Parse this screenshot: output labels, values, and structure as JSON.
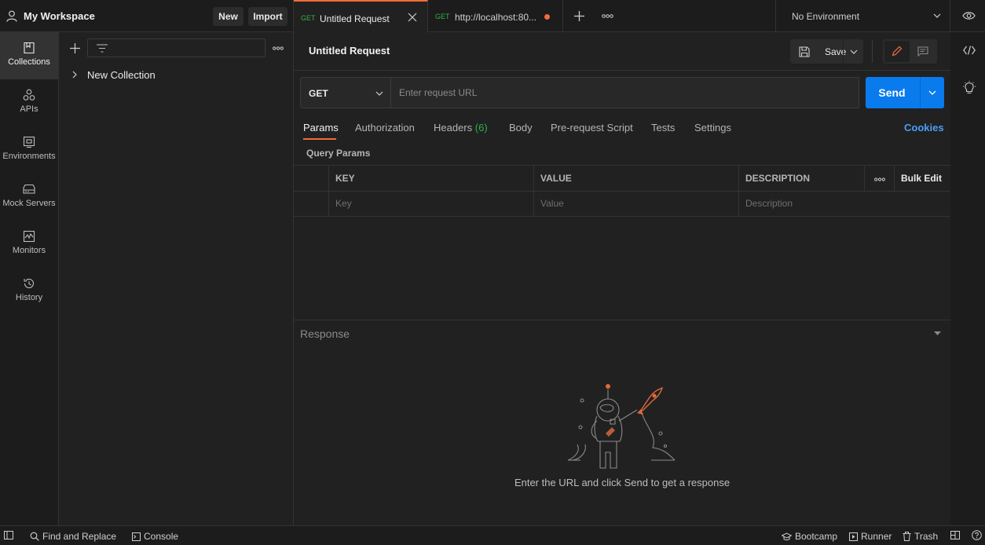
{
  "workspace": {
    "name": "My Workspace",
    "new_label": "New",
    "import_label": "Import"
  },
  "tabs": [
    {
      "method": "GET",
      "title": "Untitled Request",
      "active": true
    },
    {
      "method": "GET",
      "title": "http://localhost:80...",
      "unsaved": true
    }
  ],
  "environment": {
    "selected": "No Environment"
  },
  "rail": [
    {
      "label": "Collections",
      "icon": "collections-icon"
    },
    {
      "label": "APIs",
      "icon": "apis-icon"
    },
    {
      "label": "Environments",
      "icon": "environments-icon"
    },
    {
      "label": "Mock Servers",
      "icon": "mock-servers-icon"
    },
    {
      "label": "Monitors",
      "icon": "monitors-icon"
    },
    {
      "label": "History",
      "icon": "history-icon"
    }
  ],
  "sidebar": {
    "collections": [
      {
        "name": "New Collection"
      }
    ]
  },
  "request": {
    "title": "Untitled Request",
    "save_label": "Save",
    "method": "GET",
    "url_placeholder": "Enter request URL",
    "send_label": "Send"
  },
  "request_tabs": {
    "params": "Params",
    "authorization": "Authorization",
    "headers": "Headers",
    "headers_count": "(6)",
    "body": "Body",
    "prerequest": "Pre-request Script",
    "tests": "Tests",
    "settings": "Settings",
    "cookies": "Cookies"
  },
  "query_params": {
    "title": "Query Params",
    "columns": {
      "key": "KEY",
      "value": "VALUE",
      "description": "DESCRIPTION"
    },
    "bulk_edit": "Bulk Edit",
    "placeholders": {
      "key": "Key",
      "value": "Value",
      "description": "Description"
    }
  },
  "response": {
    "title": "Response",
    "empty_message": "Enter the URL and click Send to get a response"
  },
  "footer": {
    "find_replace": "Find and Replace",
    "console": "Console",
    "bootcamp": "Bootcamp",
    "runner": "Runner",
    "trash": "Trash"
  },
  "colors": {
    "accent": "#f26b3a",
    "send": "#097bed",
    "get": "#2fb24a",
    "link": "#4a9ff5",
    "background": "#212121"
  }
}
